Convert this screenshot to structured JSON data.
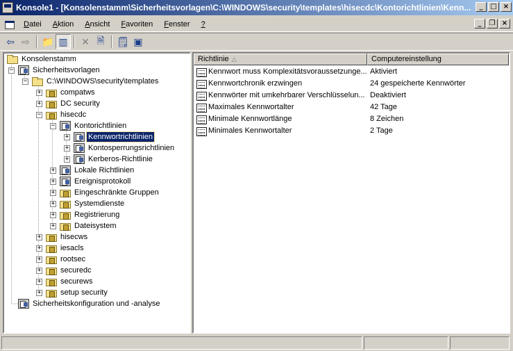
{
  "window": {
    "title": "Konsole1 - [Konsolenstamm\\Sicherheitsvorlagen\\C:\\WINDOWS\\security\\templates\\hisecdc\\Kontorichtlinien\\Kenn...",
    "minimize": "_",
    "maximize": "□",
    "close": "×"
  },
  "menu": {
    "items": [
      {
        "acc": "D",
        "rest": "atei"
      },
      {
        "acc": "A",
        "rest": "ktion"
      },
      {
        "acc": "A",
        "rest": "nsicht"
      },
      {
        "acc": "F",
        "rest": "avoriten"
      },
      {
        "acc": "F",
        "rest": "enster"
      },
      {
        "acc": "?",
        "rest": ""
      }
    ],
    "mdi_minimize": "_",
    "mdi_restore": "❐",
    "mdi_close": "×"
  },
  "toolbar": {
    "back": "⇦",
    "forward": "⇨",
    "up": "📁",
    "show_tree": "▥",
    "delete": "✕",
    "export": "🗎",
    "properties": "🗒",
    "help": "▣"
  },
  "tree": {
    "root": "Konsolenstamm",
    "sicherheitsvorlagen": "Sicherheitsvorlagen",
    "templates_path": "C:\\WINDOWS\\security\\templates",
    "compatws": "compatws",
    "dc_security": "DC security",
    "hisecdc": "hisecdc",
    "kontorichtlinien": "Kontorichtlinien",
    "kennwortrichtlinien": "Kennwortrichtlinien",
    "kontosperrungsrichtlinien": "Kontosperrungsrichtlinien",
    "kerberos": "Kerberos-Richtlinie",
    "lokale": "Lokale Richtlinien",
    "ereignisprotokoll": "Ereignisprotokoll",
    "gruppen": "Eingeschränkte Gruppen",
    "systemdienste": "Systemdienste",
    "registrierung": "Registrierung",
    "dateisystem": "Dateisystem",
    "hisecws": "hisecws",
    "iesacls": "iesacls",
    "rootsec": "rootsec",
    "securedc": "securedc",
    "securews": "securews",
    "setup_security": "setup security",
    "sicherheitskonfiguration": "Sicherheitskonfiguration und -analyse",
    "plus": "+",
    "minus": "−"
  },
  "list": {
    "col_policy": "Richtlinie",
    "col_setting": "Computereinstellung",
    "sort_indicator": "△",
    "rows": [
      {
        "policy": "Kennwort muss Komplexitätsvoraussetzunge...",
        "setting": "Aktiviert"
      },
      {
        "policy": "Kennwortchronik erzwingen",
        "setting": "24 gespeicherte Kennwörter"
      },
      {
        "policy": "Kennwörter mit umkehrbarer Verschlüsselun...",
        "setting": "Deaktiviert"
      },
      {
        "policy": "Maximales Kennwortalter",
        "setting": "42 Tage"
      },
      {
        "policy": "Minimale Kennwortlänge",
        "setting": "8 Zeichen"
      },
      {
        "policy": "Minimales Kennwortalter",
        "setting": "2 Tage"
      }
    ]
  }
}
